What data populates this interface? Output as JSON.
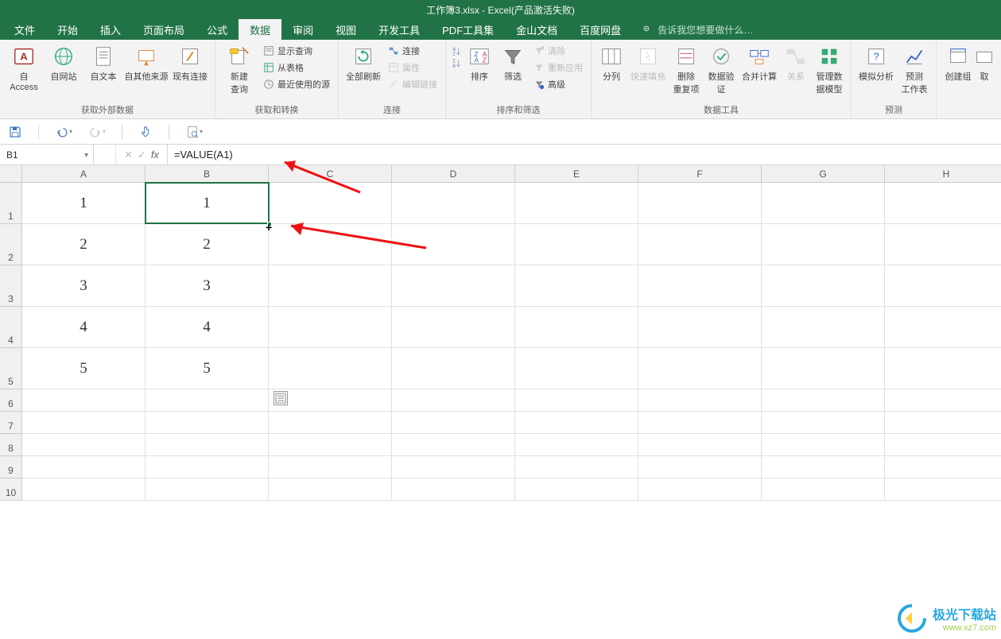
{
  "title": "工作簿3.xlsx - Excel(产品激活失败)",
  "menu": [
    "文件",
    "开始",
    "插入",
    "页面布局",
    "公式",
    "数据",
    "审阅",
    "视图",
    "开发工具",
    "PDF工具集",
    "金山文档",
    "百度网盘"
  ],
  "active_menu_index": 5,
  "tell_me": "告诉我您想要做什么…",
  "ribbon": {
    "g1": {
      "label": "获取外部数据",
      "btns": [
        "自 Access",
        "自网站",
        "自文本",
        "自其他来源",
        "现有连接"
      ]
    },
    "g2": {
      "label": "获取和转换",
      "big": "新建\n查询",
      "small": [
        "显示查询",
        "从表格",
        "最近使用的源"
      ]
    },
    "g3": {
      "label": "连接",
      "big": "全部刷新",
      "small": [
        "连接",
        "属性",
        "编辑链接"
      ]
    },
    "g4": {
      "label": "排序和筛选",
      "sortAZ": "",
      "sortZA": "",
      "sort": "排序",
      "filter": "筛选",
      "small": [
        "清除",
        "重新应用",
        "高级"
      ]
    },
    "g5": {
      "label": "数据工具",
      "btns": [
        "分列",
        "快速填充",
        "删除\n重复项",
        "数据验\n证",
        "合并计算",
        "关系",
        "管理数\n据模型"
      ]
    },
    "g6": {
      "label": "预测",
      "btns": [
        "模拟分析",
        "预测\n工作表"
      ]
    },
    "g7": {
      "btns": [
        "创建组",
        "取"
      ]
    }
  },
  "name_box": "B1",
  "formula": "=VALUE(A1)",
  "cols": [
    "A",
    "B",
    "C",
    "D",
    "E",
    "F",
    "G",
    "H"
  ],
  "rows": [
    "1",
    "2",
    "3",
    "4",
    "5",
    "6",
    "7",
    "8",
    "9",
    "10"
  ],
  "cell_data": {
    "A": [
      "1",
      "2",
      "3",
      "4",
      "5"
    ],
    "B": [
      "1",
      "2",
      "3",
      "4",
      "5"
    ]
  },
  "watermark": {
    "line1": "极光下载站",
    "line2": "www.xz7.com"
  }
}
